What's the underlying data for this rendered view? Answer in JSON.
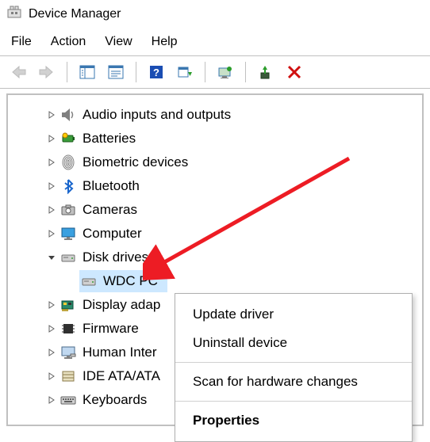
{
  "window": {
    "title": "Device Manager"
  },
  "menubar": {
    "file": "File",
    "action": "Action",
    "view": "View",
    "help": "Help"
  },
  "tree": {
    "audio": "Audio inputs and outputs",
    "batteries": "Batteries",
    "biometric": "Biometric devices",
    "bluetooth": "Bluetooth",
    "cameras": "Cameras",
    "computer": "Computer",
    "disk": "Disk drives",
    "disk_child": "WDC PC",
    "display": "Display adap",
    "firmware": "Firmware",
    "human": "Human Inter",
    "ide": "IDE ATA/ATA",
    "keyboards": "Keyboards"
  },
  "context": {
    "update": "Update driver",
    "uninstall": "Uninstall device",
    "scan": "Scan for hardware changes",
    "properties": "Properties"
  }
}
